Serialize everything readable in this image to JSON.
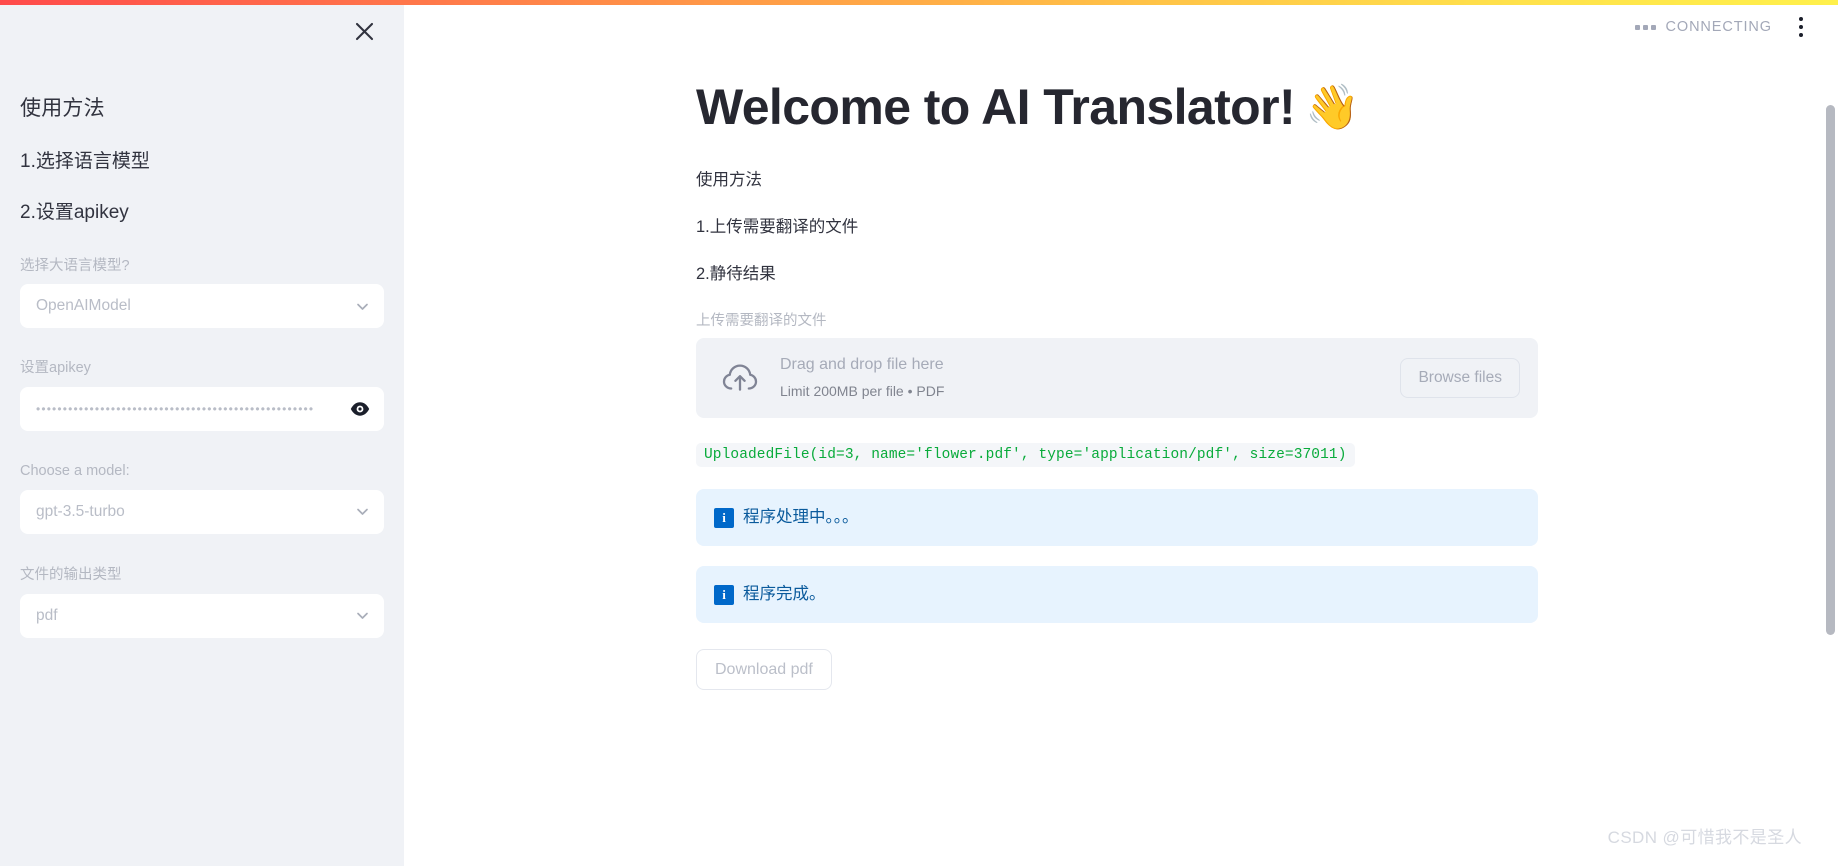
{
  "window": {
    "top_gradient_colors": [
      "#ff4b4b",
      "#ff9a47",
      "#ffe14b"
    ],
    "watermark": "CSDN @可惜我不是圣人"
  },
  "status": {
    "running_text": "CONNECTING",
    "running_dots_icon": "running-dots-icon",
    "menu_icon": "kebab-menu-icon"
  },
  "sidebar": {
    "close_icon": "close-icon",
    "heading": "使用方法",
    "steps": [
      "1.选择语言模型",
      "2.设置apikey"
    ],
    "fields": [
      {
        "label": "选择大语言模型?",
        "value": "OpenAIModel",
        "type": "select",
        "icon": "chevron-down-icon"
      },
      {
        "label": "设置apikey",
        "value": "••••••••••••••••••••••••••••••••••••••••••••••••••••",
        "type": "password",
        "icon": "eye-icon"
      },
      {
        "label": "Choose a model:",
        "value": "gpt-3.5-turbo",
        "type": "select",
        "icon": "chevron-down-icon"
      },
      {
        "label": "文件的输出类型",
        "value": "pdf",
        "type": "select",
        "icon": "chevron-down-icon"
      }
    ]
  },
  "main": {
    "title": "Welcome to AI Translator!",
    "title_emoji": "👋",
    "paragraphs": [
      "使用方法",
      "1.上传需要翻译的文件",
      "2.静待结果"
    ],
    "uploader": {
      "label": "上传需要翻译的文件",
      "icon": "cloud-upload-icon",
      "drag_text": "Drag and drop file here",
      "limit_text": "Limit 200MB per file • PDF",
      "browse_label": "Browse files"
    },
    "code_output": "UploadedFile(id=3, name='flower.pdf', type='application/pdf', size=37011)",
    "alerts": [
      {
        "icon": "info-icon",
        "text": "程序处理中。。。"
      },
      {
        "icon": "info-icon",
        "text": "程序完成。"
      }
    ],
    "download_label": "Download pdf"
  },
  "colors": {
    "sidebar_bg": "#f0f2f6",
    "accent_code_green": "#09ab3b",
    "alert_bg": "#e7f3fe",
    "alert_icon_blue": "#0068c9",
    "alert_text_blue": "#0a5a9c"
  }
}
